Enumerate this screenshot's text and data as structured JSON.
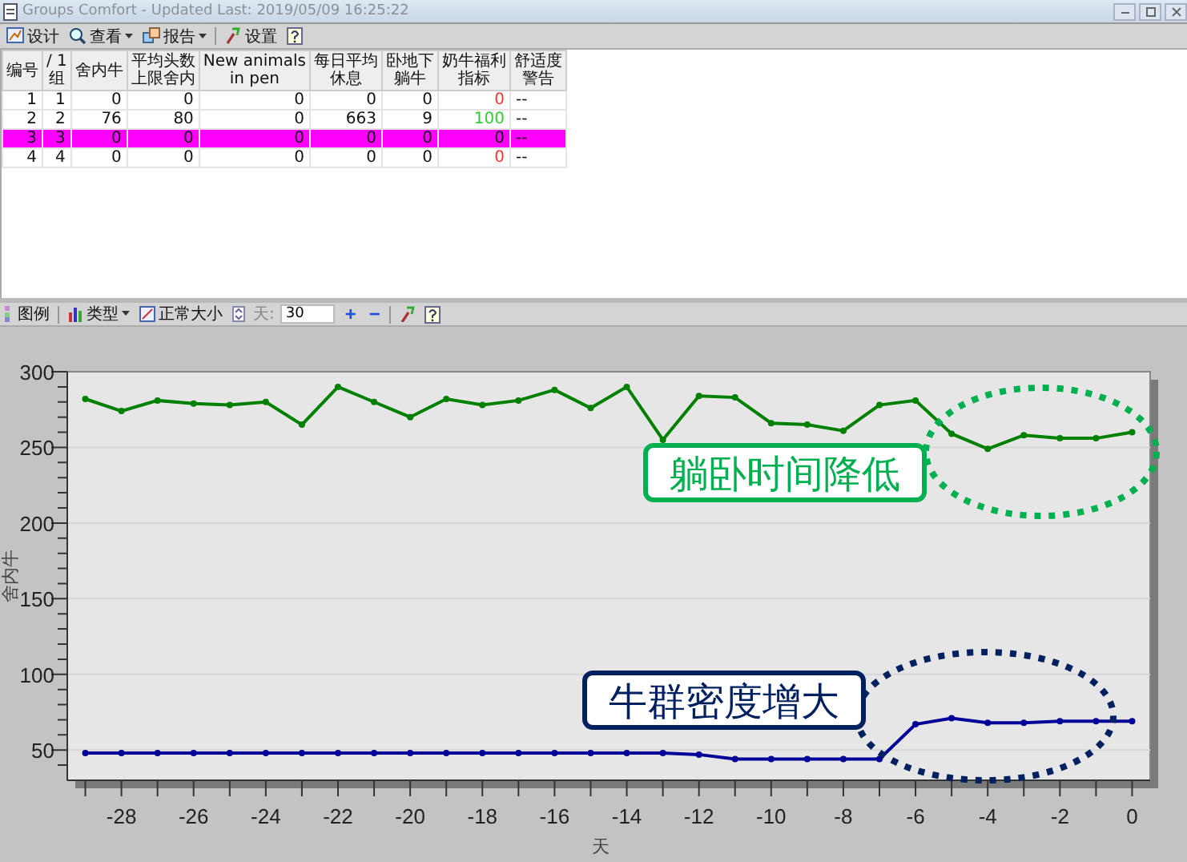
{
  "window": {
    "title": "Groups Comfort - Updated Last: 2019/05/09 16:25:22"
  },
  "toolbar": [
    {
      "label": "设计",
      "kind": "design",
      "dropdown": false
    },
    {
      "label": "查看",
      "kind": "view",
      "dropdown": true
    },
    {
      "label": "报告",
      "kind": "report",
      "dropdown": true
    },
    {
      "label": "设置",
      "kind": "settings",
      "dropdown": false
    },
    {
      "kind": "help",
      "dropdown": false
    }
  ],
  "table": {
    "columns": [
      "编号",
      "/ 1\n组",
      "舍内牛",
      "平均头数上限舍内",
      "New animals\nin pen",
      "每日平均休息",
      "卧地下躺牛",
      "奶牛福利指标",
      "舒适度警告"
    ],
    "rows": [
      {
        "selected": false,
        "cells": [
          "1",
          "1",
          "0",
          "0",
          "0",
          "0",
          "0"
        ],
        "welfare": {
          "text": "0",
          "color": "#ff3333"
        },
        "warning": "--"
      },
      {
        "selected": false,
        "cells": [
          "2",
          "2",
          "76",
          "80",
          "0",
          "663",
          "9"
        ],
        "welfare": {
          "text": "100",
          "color": "#33cc33"
        },
        "warning": "--"
      },
      {
        "selected": true,
        "cells": [
          "3",
          "3",
          "0",
          "0",
          "0",
          "0",
          "0"
        ],
        "welfare": {
          "text": "0"
        },
        "warning": "--"
      },
      {
        "selected": false,
        "cells": [
          "4",
          "4",
          "0",
          "0",
          "0",
          "0",
          "0"
        ],
        "welfare": {
          "text": "0",
          "color": "#ff3333"
        },
        "warning": "--"
      }
    ]
  },
  "chart_toolbar": {
    "legend": "图例",
    "type": "类型",
    "normal_size": "正常大小",
    "days_label": "天:",
    "days_value": "30",
    "plus": "+",
    "minus": "−"
  },
  "chart": {
    "chart_data": {
      "type": "line",
      "xlabel": "天",
      "ylabel": "舍内牛",
      "grid": true,
      "x": [
        -29,
        -28,
        -27,
        -26,
        -25,
        -24,
        -23,
        -22,
        -21,
        -20,
        -19,
        -18,
        -17,
        -16,
        -15,
        -14,
        -13,
        -12,
        -11,
        -10,
        -9,
        -8,
        -7,
        -6,
        -5,
        -4,
        -3,
        -2,
        -1,
        0
      ],
      "series": [
        {
          "color": "#008000",
          "marker": "o",
          "values": [
            282,
            274,
            281,
            279,
            278,
            280,
            265,
            290,
            280,
            270,
            282,
            278,
            281,
            288,
            276,
            290,
            255,
            284,
            283,
            266,
            265,
            261,
            278,
            281,
            259,
            249,
            258,
            256,
            256,
            260
          ]
        },
        {
          "color": "#000099",
          "marker": "o",
          "values": [
            48,
            48,
            48,
            48,
            48,
            48,
            48,
            48,
            48,
            48,
            48,
            48,
            48,
            48,
            48,
            48,
            48,
            47,
            44,
            44,
            44,
            44,
            44,
            67,
            71,
            68,
            68,
            69,
            69,
            69
          ]
        }
      ],
      "xlim": [
        -29.5,
        0.5
      ],
      "ylim": [
        30,
        300
      ],
      "xticks": [
        -28,
        -26,
        -24,
        -22,
        -20,
        -18,
        -16,
        -14,
        -12,
        -10,
        -8,
        -6,
        -4,
        -2,
        0
      ],
      "yticks": [
        50,
        100,
        150,
        200,
        250,
        300
      ],
      "annotations": [
        "躺卧时间降低",
        "牛群密度增大"
      ]
    }
  }
}
